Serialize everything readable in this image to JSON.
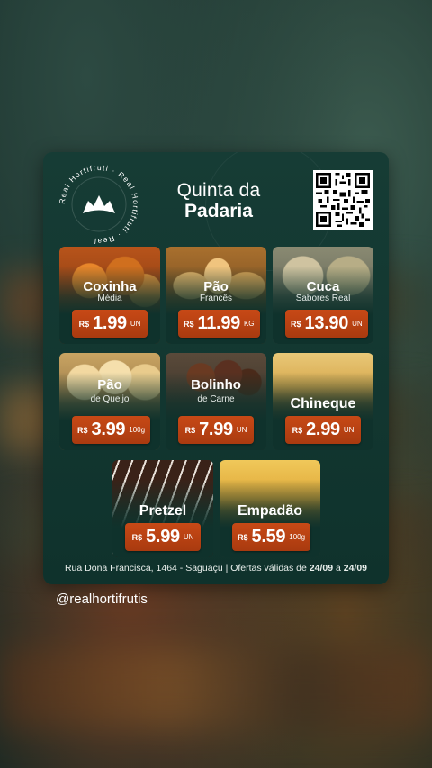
{
  "brand": {
    "seal_text": "Real Hortifruti · Real Hortifruti ·"
  },
  "header": {
    "title_line1": "Quinta da",
    "title_line2": "Padaria"
  },
  "products": [
    {
      "name": "Coxinha",
      "sub": "Média",
      "currency": "R$",
      "price": "1.99",
      "unit": "UN"
    },
    {
      "name": "Pão",
      "sub": "Francês",
      "currency": "R$",
      "price": "11.99",
      "unit": "KG"
    },
    {
      "name": "Cuca",
      "sub": "Sabores Real",
      "currency": "R$",
      "price": "13.90",
      "unit": "UN"
    },
    {
      "name": "Pão",
      "sub": "de Queijo",
      "currency": "R$",
      "price": "3.99",
      "unit": "100g"
    },
    {
      "name": "Bolinho",
      "sub": "de Carne",
      "currency": "R$",
      "price": "7.99",
      "unit": "UN"
    },
    {
      "name": "Chineque",
      "currency": "R$",
      "price": "2.99",
      "unit": "UN"
    },
    {
      "name": "Pretzel",
      "currency": "R$",
      "price": "5.99",
      "unit": "UN"
    },
    {
      "name": "Empadão",
      "currency": "R$",
      "price": "5.59",
      "unit": "100g"
    }
  ],
  "footer": {
    "text": "Rua Dona Francisca, 1464 - Saguaçu | Ofertas válidas de ",
    "date_from": "24/09",
    "joiner": " a ",
    "date_to": "24/09"
  },
  "post": {
    "handle": "@realhortifrutis"
  },
  "colors": {
    "card": "#0f322c",
    "price_tag": "#c74916"
  }
}
